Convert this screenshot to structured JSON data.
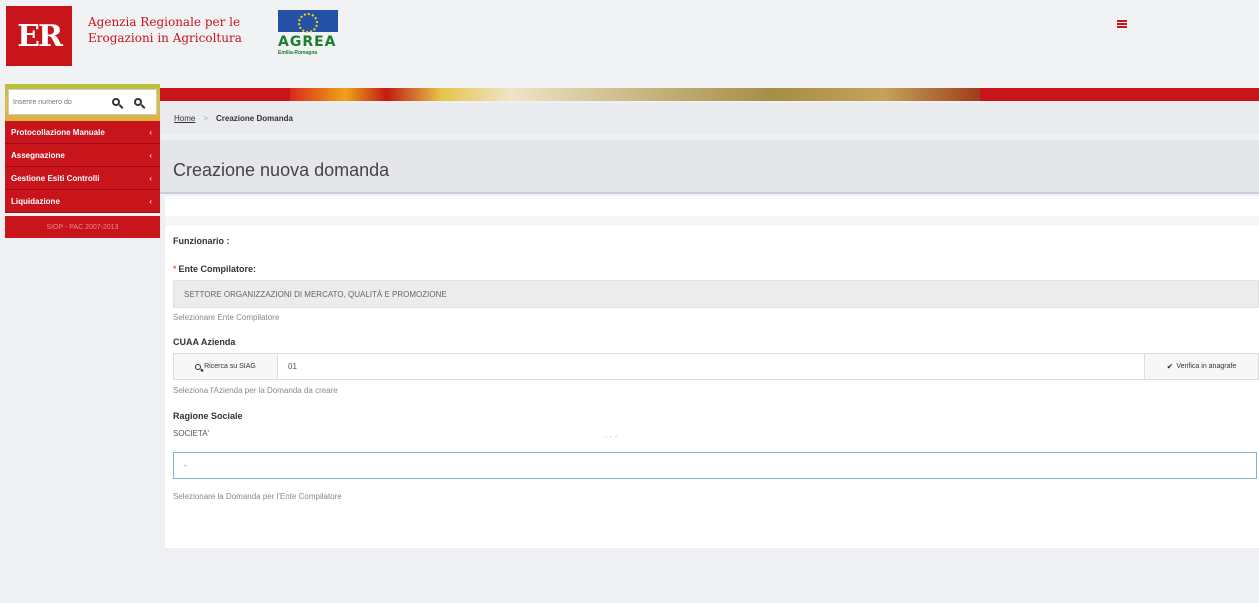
{
  "header": {
    "logo_text": "ER",
    "agency_line1": "Agenzia Regionale per le",
    "agency_line2": "Erogazioni in Agricoltura",
    "agrea_logo": "AGREA",
    "agrea_sub": "Emilia-Romagna",
    "menu_icon": "hamburger-icon",
    "brand_color": "#c8141b"
  },
  "sidebar": {
    "search_placeholder": "Inserire numero do",
    "search_icons": [
      "search-icon",
      "search-icon"
    ],
    "items": [
      {
        "label": "Protocollazione Manuale",
        "chevron": "‹"
      },
      {
        "label": "Assegnazione",
        "chevron": "‹"
      },
      {
        "label": "Gestione Esiti Controlli",
        "chevron": "‹"
      },
      {
        "label": "Liquidazione",
        "chevron": "‹"
      }
    ],
    "footer": "SIOP - PAC 2007-2013"
  },
  "breadcrumb": {
    "home": "Home",
    "separator": ">",
    "current": "Creazione Domanda"
  },
  "page": {
    "title": "Creazione nuova domanda"
  },
  "form": {
    "funzionario_label": "Funzionario :",
    "ente_label": "Ente Compilatore:",
    "required_marker": "*",
    "ente_value": "SETTORE ORGANIZZAZIONI DI MERCATO, QUALITÀ E PROMOZIONE",
    "ente_help": "Selezionare Ente Compilatore",
    "cuaa_label": "CUAA Azienda",
    "cuaa_button": "Ricerca su SIAG",
    "cuaa_value": "01",
    "verifica_button": "Verifica in anagrafe",
    "cuaa_help": "Seleziona l'Azienda per la Domanda da creare",
    "ragione_label": "Ragione Sociale",
    "ragione_value": "SOCIETA'",
    "ragione_suffix": "- - -",
    "domanda_value": "-",
    "domanda_help": "Selezionare la Domanda per l'Ente Compilatore"
  }
}
